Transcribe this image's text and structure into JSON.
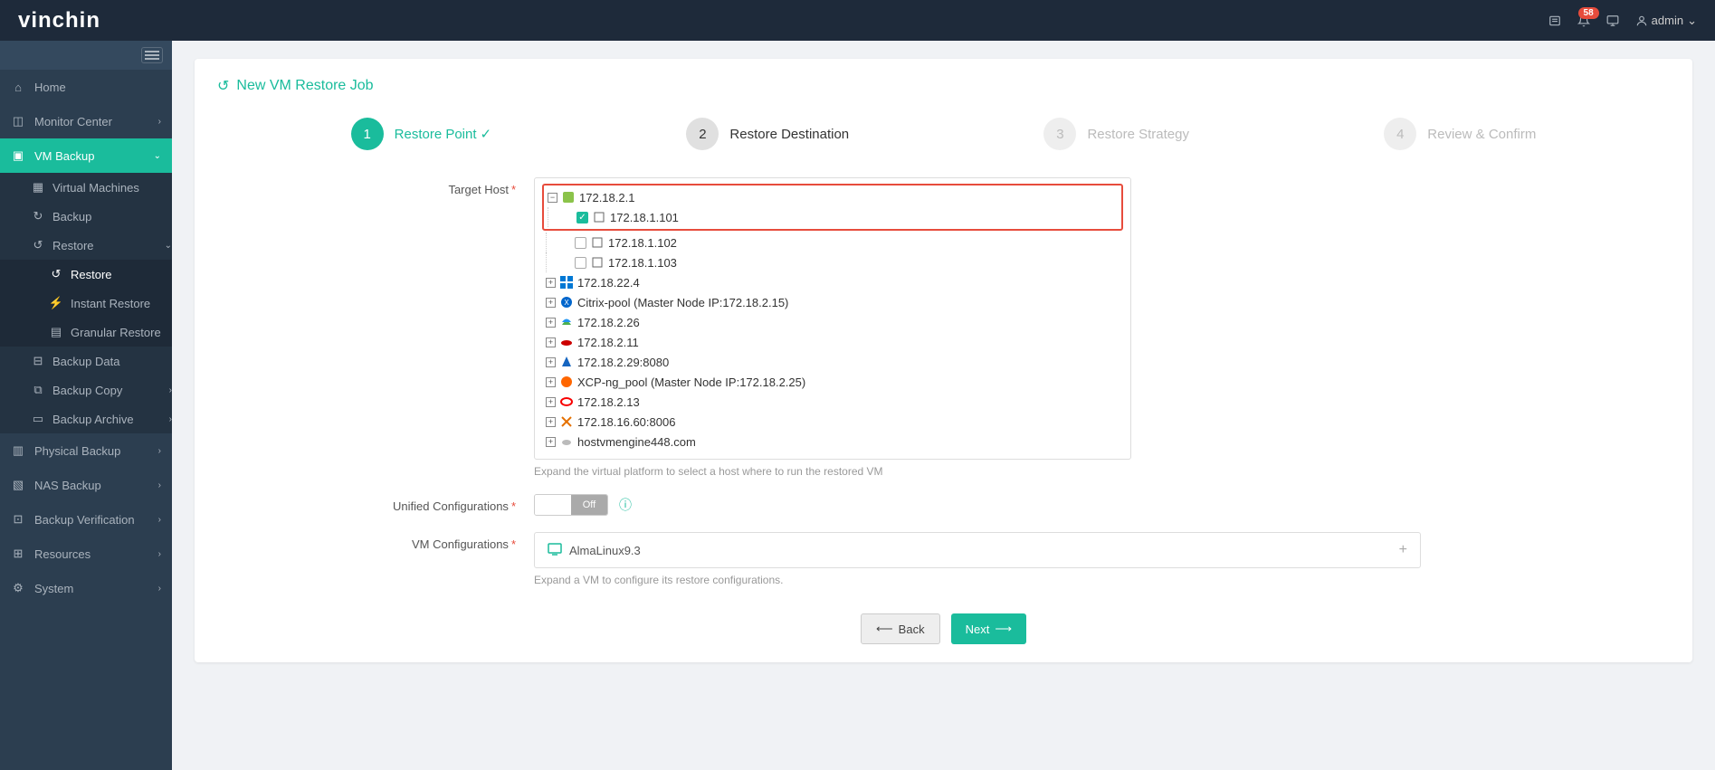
{
  "brand": "vinchin",
  "header": {
    "notification_count": "58",
    "user": "admin"
  },
  "sidebar": {
    "home": "Home",
    "monitor": "Monitor Center",
    "vm_backup": "VM Backup",
    "virtual_machines": "Virtual Machines",
    "backup": "Backup",
    "restore": "Restore",
    "restore_sub": "Restore",
    "instant_restore": "Instant Restore",
    "granular_restore": "Granular Restore",
    "backup_data": "Backup Data",
    "backup_copy": "Backup Copy",
    "backup_archive": "Backup Archive",
    "physical_backup": "Physical Backup",
    "nas_backup": "NAS Backup",
    "backup_verification": "Backup Verification",
    "resources": "Resources",
    "system": "System"
  },
  "page": {
    "title": "New VM Restore Job"
  },
  "wizard": {
    "step1": "Restore Point",
    "step2": "Restore Destination",
    "step3": "Restore Strategy",
    "step4": "Review & Confirm",
    "n1": "1",
    "n2": "2",
    "n3": "3",
    "n4": "4"
  },
  "labels": {
    "target_host": "Target Host",
    "unified_config": "Unified Configurations",
    "vm_config": "VM Configurations",
    "off": "Off"
  },
  "tree": {
    "root": "172.18.2.1",
    "child1": "172.18.1.101",
    "child2": "172.18.1.102",
    "child3": "172.18.1.103",
    "n1": "172.18.22.4",
    "n2": "Citrix-pool (Master Node IP:172.18.2.15)",
    "n3": "172.18.2.26",
    "n4": "172.18.2.11",
    "n5": "172.18.2.29:8080",
    "n6": "XCP-ng_pool (Master Node IP:172.18.2.25)",
    "n7": "172.18.2.13",
    "n8": "172.18.16.60:8006",
    "n9": "hostvmengine448.com"
  },
  "hints": {
    "target_host": "Expand the virtual platform to select a host where to run the restored VM",
    "vm_config": "Expand a VM to configure its restore configurations."
  },
  "vm_config": {
    "name": "AlmaLinux9.3"
  },
  "buttons": {
    "back": "Back",
    "next": "Next"
  }
}
